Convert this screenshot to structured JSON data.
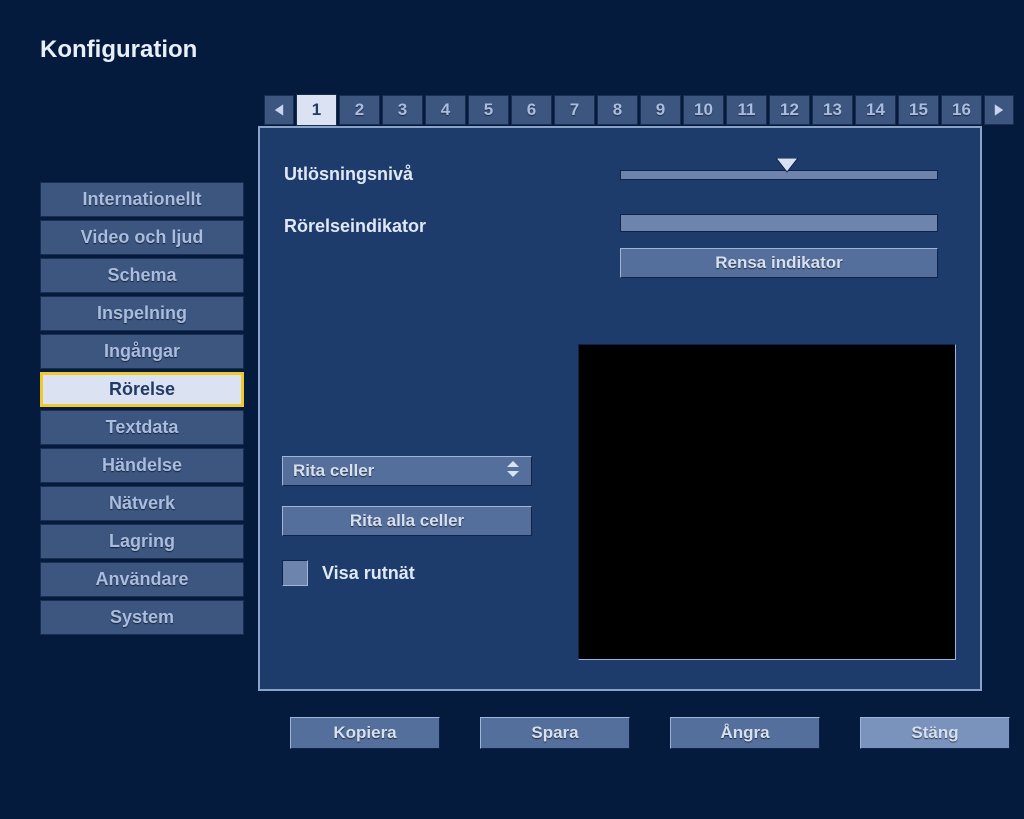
{
  "title": "Konfiguration",
  "sidebar": {
    "items": [
      "Internationellt",
      "Video och ljud",
      "Schema",
      "Inspelning",
      "Ingångar",
      "Rörelse",
      "Textdata",
      "Händelse",
      "Nätverk",
      "Lagring",
      "Användare",
      "System"
    ],
    "active_index": 5
  },
  "tabs": {
    "labels": [
      "1",
      "2",
      "3",
      "4",
      "5",
      "6",
      "7",
      "8",
      "9",
      "10",
      "11",
      "12",
      "13",
      "14",
      "15",
      "16"
    ],
    "active_index": 0
  },
  "main": {
    "trigger_label": "Utlösningsnivå",
    "trigger_value": 50,
    "indicator_label": "Rörelseindikator",
    "clear_indicator_button": "Rensa indikator",
    "draw_mode_selected": "Rita celler",
    "draw_all_button": "Rita alla celler",
    "show_grid_label": "Visa rutnät",
    "show_grid_checked": false
  },
  "footer": {
    "buttons": [
      "Kopiera",
      "Spara",
      "Ångra",
      "Stäng"
    ]
  }
}
